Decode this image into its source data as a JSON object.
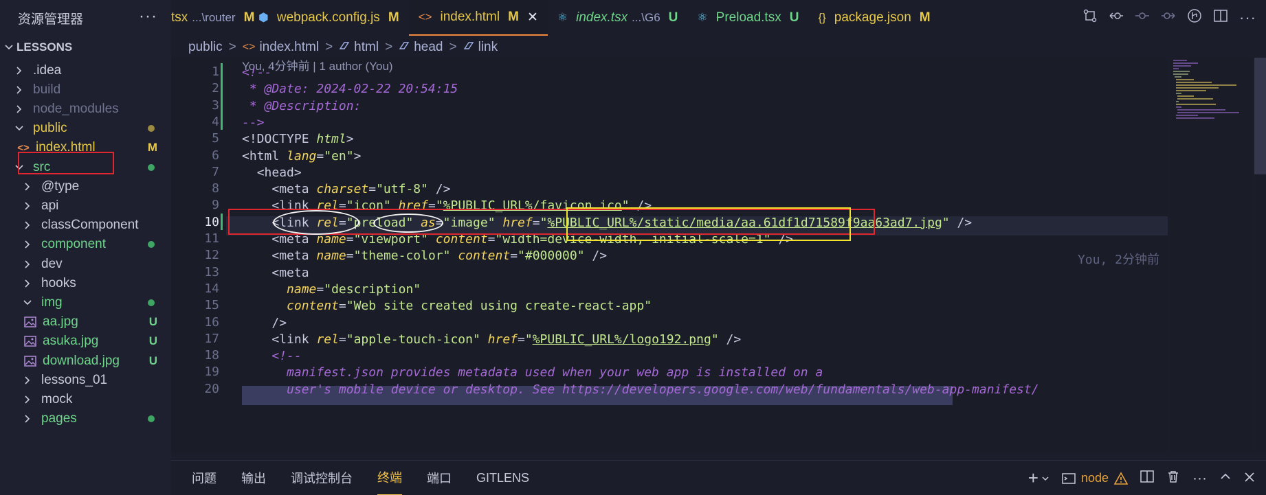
{
  "sidebar": {
    "title": "资源管理器",
    "more": "···",
    "root": "LESSONS",
    "items": [
      {
        "label": "  .idea",
        "kind": "folder",
        "open": false,
        "color": "#c8cbd9"
      },
      {
        "label": "build",
        "kind": "folder",
        "open": false,
        "color": "#6f748f"
      },
      {
        "label": "node_modules",
        "kind": "folder",
        "open": false,
        "color": "#6f748f"
      },
      {
        "label": "public",
        "kind": "folder",
        "open": true,
        "color": "#e6c84a",
        "dot": "#9c8a40"
      },
      {
        "label": "index.html",
        "kind": "file",
        "color": "#e6c84a",
        "badge": "M"
      },
      {
        "label": "src",
        "kind": "folder",
        "open": true,
        "color": "#6fd58a",
        "dot": "#3ea563"
      },
      {
        "label": "@type",
        "kind": "folder",
        "open": false,
        "color": "#c8cbd9"
      },
      {
        "label": "api",
        "kind": "folder",
        "open": false,
        "color": "#c8cbd9"
      },
      {
        "label": "classComponent",
        "kind": "folder",
        "open": false,
        "color": "#c8cbd9"
      },
      {
        "label": "component",
        "kind": "folder",
        "open": false,
        "color": "#6fd58a",
        "dot": "#3ea563"
      },
      {
        "label": "dev",
        "kind": "folder",
        "open": false,
        "color": "#c8cbd9"
      },
      {
        "label": "hooks",
        "kind": "folder",
        "open": false,
        "color": "#c8cbd9"
      },
      {
        "label": "img",
        "kind": "folder",
        "open": true,
        "color": "#6fd58a",
        "dot": "#3ea563"
      },
      {
        "label": "aa.jpg",
        "kind": "image",
        "color": "#6fd58a",
        "badge": "U"
      },
      {
        "label": "asuka.jpg",
        "kind": "image",
        "color": "#6fd58a",
        "badge": "U"
      },
      {
        "label": "download.jpg",
        "kind": "image",
        "color": "#6fd58a",
        "badge": "U"
      },
      {
        "label": "lessons_01",
        "kind": "folder",
        "open": false,
        "color": "#c8cbd9"
      },
      {
        "label": "mock",
        "kind": "folder",
        "open": false,
        "color": "#c8cbd9"
      },
      {
        "label": "pages",
        "kind": "folder",
        "open": false,
        "color": "#6fd58a",
        "dot": "#3ea563"
      }
    ]
  },
  "tabs": [
    {
      "icon": "",
      "name": "tsx",
      "dim": "...\\router",
      "status": "M",
      "color": "#e6c84a",
      "italic": false
    },
    {
      "icon": "⬢",
      "icon_color": "#6ab0f3",
      "name": "webpack.config.js",
      "dim": "",
      "status": "M",
      "color": "#e6c84a",
      "italic": false
    },
    {
      "icon": "<>",
      "icon_color": "#e3894a",
      "name": "index.html",
      "dim": "",
      "status": "M",
      "color": "#e6c84a",
      "italic": false,
      "active": true,
      "close": "✕"
    },
    {
      "icon": "⚛",
      "icon_color": "#5ec4e8",
      "name": "index.tsx",
      "dim": "...\\G6",
      "status": "U",
      "color": "#6fd58a",
      "italic": true
    },
    {
      "icon": "⚛",
      "icon_color": "#5ec4e8",
      "name": "Preload.tsx",
      "dim": "",
      "status": "U",
      "color": "#6fd58a",
      "italic": false
    },
    {
      "icon": "{}",
      "icon_color": "#e6c84a",
      "name": "package.json",
      "dim": "",
      "status": "M",
      "color": "#e6c84a",
      "italic": false
    }
  ],
  "breadcrumb": [
    "public",
    "index.html",
    "html",
    "head",
    "link"
  ],
  "blame": "You, 4分钟前 | 1 author (You)",
  "ghost_blame": "You, 2分钟前",
  "code": [
    {
      "n": "1",
      "html": "<span class=\"c-com\">&lt;!--</span>"
    },
    {
      "n": "2",
      "html": "<span class=\"c-com\"> * @Date: 2024-02-22 20:54:15</span>"
    },
    {
      "n": "3",
      "html": "<span class=\"c-com\"> * @Description:</span>"
    },
    {
      "n": "4",
      "html": "<span class=\"c-com\">--&gt;</span>"
    },
    {
      "n": "5",
      "html": "<span class=\"c-tagb\">&lt;!DOCTYPE </span><span class=\"c-kw\">html</span><span class=\"c-tagb\">&gt;</span>"
    },
    {
      "n": "6",
      "html": "<span class=\"c-tagb\">&lt;html </span><span class=\"c-attr\">lang</span><span class=\"c-pun\">=</span><span class=\"c-str\">\"en\"</span><span class=\"c-tagb\">&gt;</span>"
    },
    {
      "n": "7",
      "html": "  <span class=\"c-tagb\">&lt;head&gt;</span>"
    },
    {
      "n": "8",
      "html": "    <span class=\"c-tagb\">&lt;meta </span><span class=\"c-attr\">charset</span><span class=\"c-pun\">=</span><span class=\"c-str\">\"utf-8\"</span><span class=\"c-tagb\"> /&gt;</span>"
    },
    {
      "n": "9",
      "html": "    <span class=\"c-tagb\">&lt;link </span><span class=\"c-attr\">rel</span><span class=\"c-pun\">=</span><span class=\"c-str\">\"icon\"</span> <span class=\"c-attr\">href</span><span class=\"c-pun\">=</span><span class=\"c-str\">\"<span class=\"c-und\">%PUBLIC_URL%/favicon.ico</span>\"</span><span class=\"c-tagb\"> /&gt;</span>"
    },
    {
      "n": "10",
      "html": "    <span class=\"c-tagb\">&lt;link </span><span class=\"c-attr\">rel</span><span class=\"c-pun\">=</span><span class=\"c-str\">\"preload\"</span> <span class=\"c-attr\">as</span><span class=\"c-pun\">=</span><span class=\"c-str\">\"image\"</span> <span class=\"c-attr\">href</span><span class=\"c-pun\">=</span><span class=\"c-str\">\"<span class=\"c-und\">%PUBLIC_URL%/static/media/aa.61df1d71589f9aa63ad7.jpg</span>\"</span><span class=\"c-tagb\"> /&gt;</span>",
      "current": true
    },
    {
      "n": "11",
      "html": "    <span class=\"c-tagb\">&lt;meta </span><span class=\"c-attr\">name</span><span class=\"c-pun\">=</span><span class=\"c-str\">\"viewport\"</span> <span class=\"c-attr\">content</span><span class=\"c-pun\">=</span><span class=\"c-str\">\"width=device-width, initial-scale=1\"</span><span class=\"c-tagb\"> /&gt;</span>"
    },
    {
      "n": "12",
      "html": "    <span class=\"c-tagb\">&lt;meta </span><span class=\"c-attr\">name</span><span class=\"c-pun\">=</span><span class=\"c-str\">\"theme-color\"</span> <span class=\"c-attr\">content</span><span class=\"c-pun\">=</span><span class=\"c-str\">\"#000000\"</span><span class=\"c-tagb\"> /&gt;</span>"
    },
    {
      "n": "13",
      "html": "    <span class=\"c-tagb\">&lt;meta</span>"
    },
    {
      "n": "14",
      "html": "      <span class=\"c-attr\">name</span><span class=\"c-pun\">=</span><span class=\"c-str\">\"description\"</span>"
    },
    {
      "n": "15",
      "html": "      <span class=\"c-attr\">content</span><span class=\"c-pun\">=</span><span class=\"c-str\">\"Web site created using create-react-app\"</span>"
    },
    {
      "n": "16",
      "html": "    <span class=\"c-tagb\">/&gt;</span>"
    },
    {
      "n": "17",
      "html": "    <span class=\"c-tagb\">&lt;link </span><span class=\"c-attr\">rel</span><span class=\"c-pun\">=</span><span class=\"c-str\">\"apple-touch-icon\"</span> <span class=\"c-attr\">href</span><span class=\"c-pun\">=</span><span class=\"c-str\">\"<span class=\"c-und\">%PUBLIC_URL%/logo192.png</span>\"</span><span class=\"c-tagb\"> /&gt;</span>"
    },
    {
      "n": "18",
      "html": "    <span class=\"c-com\">&lt;!--</span>"
    },
    {
      "n": "19",
      "html": "<span class=\"c-com\">      manifest.json provides metadata used when your web app is installed on a</span>"
    },
    {
      "n": "20",
      "html": "<span class=\"c-com\">      user's mobile device or desktop. See https://developers.google.com/web/fundamentals/web-app-manifest/</span>"
    }
  ],
  "panel": {
    "tabs": [
      "问题",
      "输出",
      "调试控制台",
      "终端",
      "端口",
      "GITLENS"
    ],
    "active_tab": "终端",
    "terminal_name": "node",
    "add": "+",
    "more": "···"
  },
  "colors": {
    "modified": "#e6c84a",
    "untracked": "#6fd58a",
    "annotation_red": "#e0262e",
    "annotation_yellow": "#f0e430"
  }
}
